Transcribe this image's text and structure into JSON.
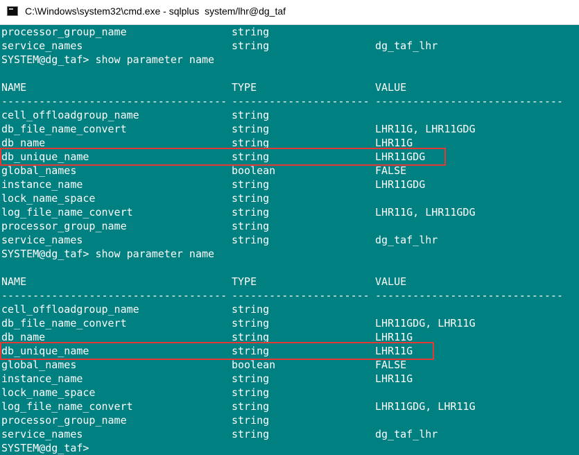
{
  "window": {
    "title": "C:\\Windows\\system32\\cmd.exe - sqlplus  system/lhr@dg_taf"
  },
  "console": {
    "lines": [
      {
        "name": "processor_group_name",
        "type": "string",
        "value": ""
      },
      {
        "name": "service_names",
        "type": "string",
        "value": "dg_taf_lhr"
      },
      {
        "prompt": "SYSTEM@dg_taf> show parameter name"
      },
      {
        "blank": true
      },
      {
        "name": "NAME",
        "type": "TYPE",
        "value": "VALUE"
      },
      {
        "name": "------------------------------------",
        "type": "----------------------",
        "value": "------------------------------"
      },
      {
        "name": "cell_offloadgroup_name",
        "type": "string",
        "value": ""
      },
      {
        "name": "db_file_name_convert",
        "type": "string",
        "value": "LHR11G, LHR11GDG"
      },
      {
        "name": "db_name",
        "type": "string",
        "value": "LHR11G"
      },
      {
        "name": "db_unique_name",
        "type": "string",
        "value": "LHR11GDG",
        "highlight": true
      },
      {
        "name": "global_names",
        "type": "boolean",
        "value": "FALSE"
      },
      {
        "name": "instance_name",
        "type": "string",
        "value": "LHR11GDG"
      },
      {
        "name": "lock_name_space",
        "type": "string",
        "value": ""
      },
      {
        "name": "log_file_name_convert",
        "type": "string",
        "value": "LHR11G, LHR11GDG"
      },
      {
        "name": "processor_group_name",
        "type": "string",
        "value": ""
      },
      {
        "name": "service_names",
        "type": "string",
        "value": "dg_taf_lhr"
      },
      {
        "prompt": "SYSTEM@dg_taf> show parameter name"
      },
      {
        "blank": true
      },
      {
        "name": "NAME",
        "type": "TYPE",
        "value": "VALUE"
      },
      {
        "name": "------------------------------------",
        "type": "----------------------",
        "value": "------------------------------"
      },
      {
        "name": "cell_offloadgroup_name",
        "type": "string",
        "value": ""
      },
      {
        "name": "db_file_name_convert",
        "type": "string",
        "value": "LHR11GDG, LHR11G"
      },
      {
        "name": "db_name",
        "type": "string",
        "value": "LHR11G"
      },
      {
        "name": "db_unique_name",
        "type": "string",
        "value": "LHR11G",
        "highlight": true
      },
      {
        "name": "global_names",
        "type": "boolean",
        "value": "FALSE"
      },
      {
        "name": "instance_name",
        "type": "string",
        "value": "LHR11G"
      },
      {
        "name": "lock_name_space",
        "type": "string",
        "value": ""
      },
      {
        "name": "log_file_name_convert",
        "type": "string",
        "value": "LHR11GDG, LHR11G"
      },
      {
        "name": "processor_group_name",
        "type": "string",
        "value": ""
      },
      {
        "name": "service_names",
        "type": "string",
        "value": "dg_taf_lhr"
      },
      {
        "prompt": "SYSTEM@dg_taf>"
      }
    ]
  },
  "colors": {
    "background": "#008080",
    "text": "#ffffff",
    "highlight_border": "#e53935"
  }
}
